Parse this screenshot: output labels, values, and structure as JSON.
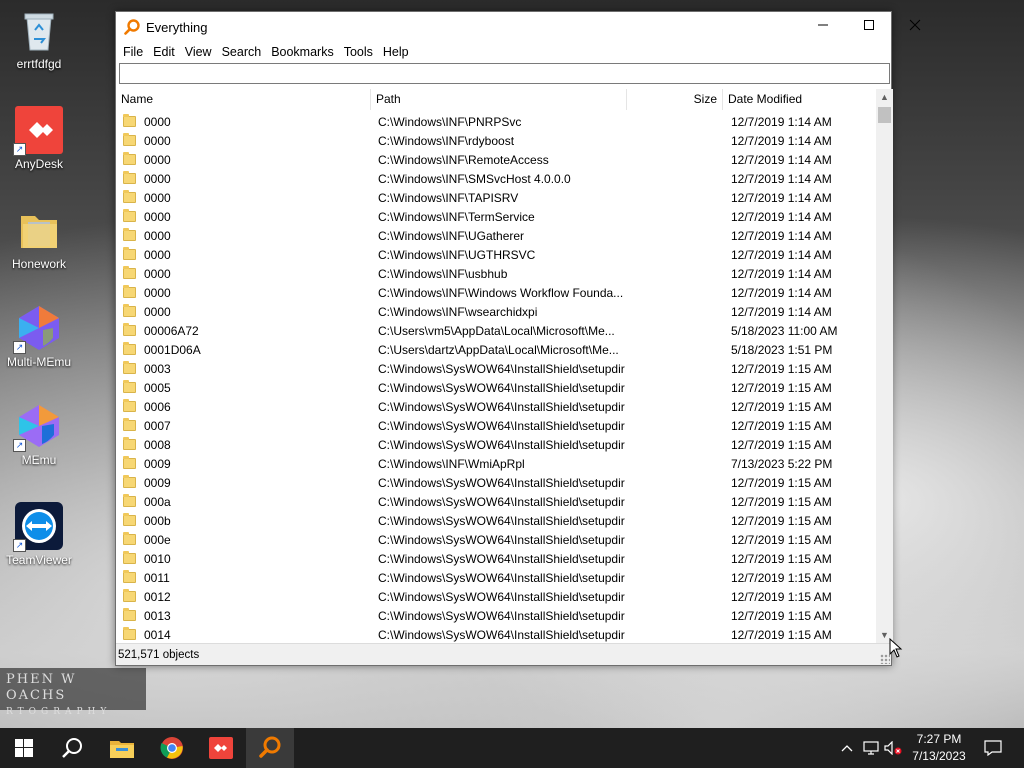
{
  "desktop": {
    "icons": [
      {
        "label": "errtfdfgd",
        "icon": "recycle-bin-icon"
      },
      {
        "label": "AnyDesk",
        "icon": "anydesk-icon"
      },
      {
        "label": "Honework",
        "icon": "folder-icon"
      },
      {
        "label": "Multi-MEmu",
        "icon": "multi-memu-icon"
      },
      {
        "label": "MEmu",
        "icon": "memu-icon"
      },
      {
        "label": "TeamViewer",
        "icon": "teamviewer-icon"
      }
    ],
    "watermark_line1": "PHEN W OACHS",
    "watermark_line2": "RTOGRAPHY"
  },
  "window": {
    "title": "Everything",
    "menu": [
      "File",
      "Edit",
      "View",
      "Search",
      "Bookmarks",
      "Tools",
      "Help"
    ],
    "search_value": "",
    "columns": {
      "name": "Name",
      "path": "Path",
      "size": "Size",
      "date": "Date Modified"
    },
    "rows": [
      {
        "name": "0000",
        "path": "C:\\Windows\\INF\\PNRPSvc",
        "date": "12/7/2019 1:14 AM"
      },
      {
        "name": "0000",
        "path": "C:\\Windows\\INF\\rdyboost",
        "date": "12/7/2019 1:14 AM"
      },
      {
        "name": "0000",
        "path": "C:\\Windows\\INF\\RemoteAccess",
        "date": "12/7/2019 1:14 AM"
      },
      {
        "name": "0000",
        "path": "C:\\Windows\\INF\\SMSvcHost 4.0.0.0",
        "date": "12/7/2019 1:14 AM"
      },
      {
        "name": "0000",
        "path": "C:\\Windows\\INF\\TAPISRV",
        "date": "12/7/2019 1:14 AM"
      },
      {
        "name": "0000",
        "path": "C:\\Windows\\INF\\TermService",
        "date": "12/7/2019 1:14 AM"
      },
      {
        "name": "0000",
        "path": "C:\\Windows\\INF\\UGatherer",
        "date": "12/7/2019 1:14 AM"
      },
      {
        "name": "0000",
        "path": "C:\\Windows\\INF\\UGTHRSVC",
        "date": "12/7/2019 1:14 AM"
      },
      {
        "name": "0000",
        "path": "C:\\Windows\\INF\\usbhub",
        "date": "12/7/2019 1:14 AM"
      },
      {
        "name": "0000",
        "path": "C:\\Windows\\INF\\Windows Workflow Founda...",
        "date": "12/7/2019 1:14 AM"
      },
      {
        "name": "0000",
        "path": "C:\\Windows\\INF\\wsearchidxpi",
        "date": "12/7/2019 1:14 AM"
      },
      {
        "name": "00006A72",
        "path": "C:\\Users\\vm5\\AppData\\Local\\Microsoft\\Me...",
        "date": "5/18/2023 11:00 AM"
      },
      {
        "name": "0001D06A",
        "path": "C:\\Users\\dartz\\AppData\\Local\\Microsoft\\Me...",
        "date": "5/18/2023 1:51 PM"
      },
      {
        "name": "0003",
        "path": "C:\\Windows\\SysWOW64\\InstallShield\\setupdir",
        "date": "12/7/2019 1:15 AM"
      },
      {
        "name": "0005",
        "path": "C:\\Windows\\SysWOW64\\InstallShield\\setupdir",
        "date": "12/7/2019 1:15 AM"
      },
      {
        "name": "0006",
        "path": "C:\\Windows\\SysWOW64\\InstallShield\\setupdir",
        "date": "12/7/2019 1:15 AM"
      },
      {
        "name": "0007",
        "path": "C:\\Windows\\SysWOW64\\InstallShield\\setupdir",
        "date": "12/7/2019 1:15 AM"
      },
      {
        "name": "0008",
        "path": "C:\\Windows\\SysWOW64\\InstallShield\\setupdir",
        "date": "12/7/2019 1:15 AM"
      },
      {
        "name": "0009",
        "path": "C:\\Windows\\INF\\WmiApRpl",
        "date": "7/13/2023 5:22 PM"
      },
      {
        "name": "0009",
        "path": "C:\\Windows\\SysWOW64\\InstallShield\\setupdir",
        "date": "12/7/2019 1:15 AM"
      },
      {
        "name": "000a",
        "path": "C:\\Windows\\SysWOW64\\InstallShield\\setupdir",
        "date": "12/7/2019 1:15 AM"
      },
      {
        "name": "000b",
        "path": "C:\\Windows\\SysWOW64\\InstallShield\\setupdir",
        "date": "12/7/2019 1:15 AM"
      },
      {
        "name": "000e",
        "path": "C:\\Windows\\SysWOW64\\InstallShield\\setupdir",
        "date": "12/7/2019 1:15 AM"
      },
      {
        "name": "0010",
        "path": "C:\\Windows\\SysWOW64\\InstallShield\\setupdir",
        "date": "12/7/2019 1:15 AM"
      },
      {
        "name": "0011",
        "path": "C:\\Windows\\SysWOW64\\InstallShield\\setupdir",
        "date": "12/7/2019 1:15 AM"
      },
      {
        "name": "0012",
        "path": "C:\\Windows\\SysWOW64\\InstallShield\\setupdir",
        "date": "12/7/2019 1:15 AM"
      },
      {
        "name": "0013",
        "path": "C:\\Windows\\SysWOW64\\InstallShield\\setupdir",
        "date": "12/7/2019 1:15 AM"
      },
      {
        "name": "0014",
        "path": "C:\\Windows\\SysWOW64\\InstallShield\\setupdir",
        "date": "12/7/2019 1:15 AM"
      }
    ],
    "status": "521,571 objects"
  },
  "taskbar": {
    "apps": [
      "start-icon",
      "search-icon",
      "file-explorer-icon",
      "chrome-icon",
      "anydesk-icon",
      "everything-icon"
    ],
    "time": "7:27 PM",
    "date": "7/13/2023"
  },
  "colors": {
    "taskbar": "#1f1f1f",
    "anydesk": "#ef443b",
    "teamviewer": "#0e8ee9",
    "folder": "#f7d774"
  }
}
